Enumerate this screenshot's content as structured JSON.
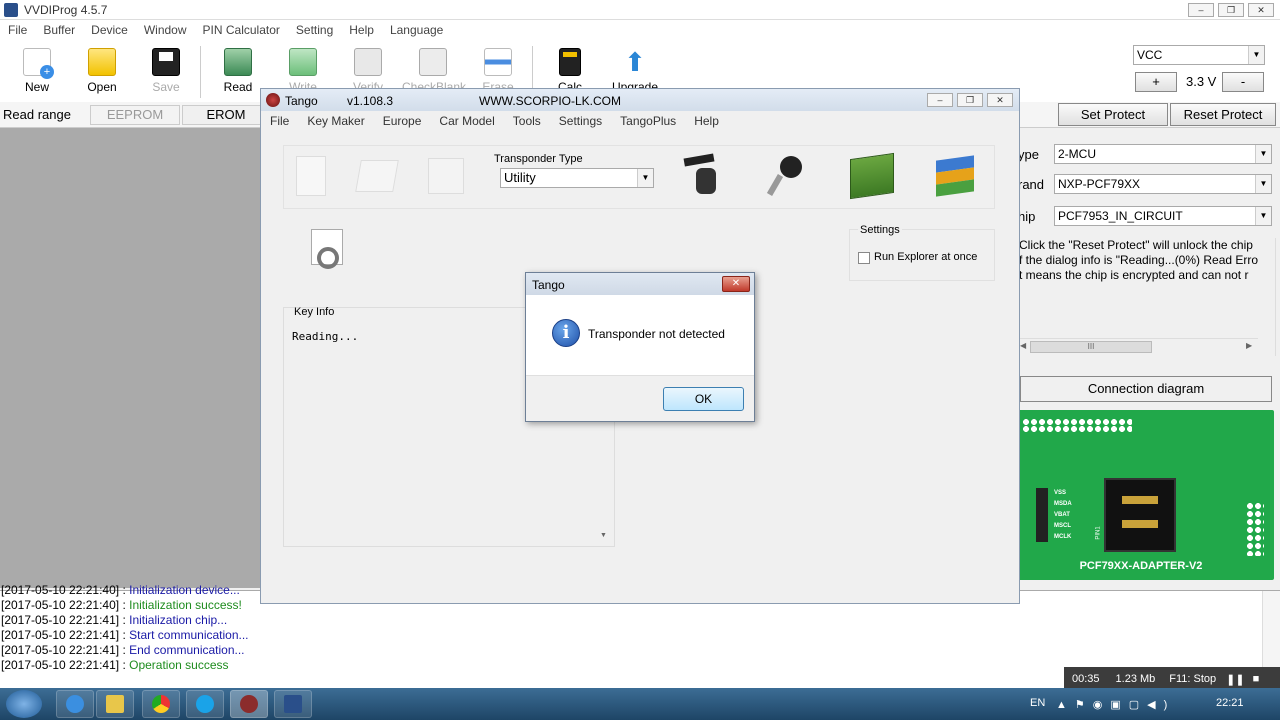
{
  "main_window": {
    "title": "VVDIProg 4.5.7",
    "menu": [
      "File",
      "Buffer",
      "Device",
      "Window",
      "PIN Calculator",
      "Setting",
      "Help",
      "Language"
    ],
    "toolbar": [
      {
        "label": "New",
        "icon": "new-file-icon",
        "enabled": true
      },
      {
        "label": "Open",
        "icon": "folder-icon",
        "enabled": true
      },
      {
        "label": "Save",
        "icon": "floppy-icon",
        "enabled": false
      },
      {
        "label": "Read",
        "icon": "read-icon",
        "enabled": true
      },
      {
        "label": "Write",
        "icon": "write-icon",
        "enabled": false
      },
      {
        "label": "Verify",
        "icon": "verify-icon",
        "enabled": false
      },
      {
        "label": "CheckBlank",
        "icon": "checkblank-icon",
        "enabled": false
      },
      {
        "label": "Erase",
        "icon": "erase-icon",
        "enabled": false
      },
      {
        "label": "Calc",
        "icon": "calculator-icon",
        "enabled": true
      },
      {
        "label": "Upgrade",
        "icon": "upgrade-arrow-icon",
        "enabled": true
      }
    ],
    "voltage": {
      "selected": "VCC",
      "value": "3.3 V",
      "plus": "+",
      "minus": "-"
    },
    "read_range_label": "Read range",
    "tabs": [
      "EEPROM",
      "EROM"
    ],
    "set_protect": "Set Protect",
    "reset_protect": "Reset Protect",
    "type_label": "ype",
    "type_value": "2-MCU",
    "brand_label": "rand",
    "brand_value": "NXP-PCF79XX",
    "chip_label": "hip",
    "chip_value": "PCF7953_IN_CIRCUIT",
    "info_lines": [
      "Click the \"Reset Protect\" will unlock the chip",
      "f the dialog info is \"Reading...(0%) Read Erro",
      "t means the chip is encrypted and can not r"
    ],
    "scroll_thumb": "III",
    "connection_button": "Connection diagram",
    "adapter": {
      "title": "PCF79XX-ADAPTER-V2",
      "pins": [
        "VSS",
        "MSDA",
        "VBAT",
        "MSCL",
        "MCLK"
      ],
      "pin1": "PIN1"
    }
  },
  "log": [
    {
      "time": "[2017-05-10 22:21:40]",
      "msg": "Initialization device...",
      "color": "#1a1aa6"
    },
    {
      "time": "[2017-05-10 22:21:40]",
      "msg": "Initialization success!",
      "color": "#1e8c1e"
    },
    {
      "time": "[2017-05-10 22:21:41]",
      "msg": "Initialization chip...",
      "color": "#1a1aa6"
    },
    {
      "time": "[2017-05-10 22:21:41]",
      "msg": "Start communication...",
      "color": "#1a1aa6"
    },
    {
      "time": "[2017-05-10 22:21:41]",
      "msg": "End communication...",
      "color": "#1a1aa6"
    },
    {
      "time": "[2017-05-10 22:21:41]",
      "msg": "Operation success",
      "color": "#1e8c1e"
    }
  ],
  "recorder": {
    "time": "00:35",
    "size": "1.23 Mb",
    "stop": "F11: Stop"
  },
  "tray": {
    "lang": "EN",
    "clock": "22:21"
  },
  "tango": {
    "title": "Tango",
    "version": "v1.108.3",
    "website": "WWW.SCORPIO-LK.COM",
    "menu": [
      "File",
      "Key Maker",
      "Europe",
      "Car Model",
      "Tools",
      "Settings",
      "TangoPlus",
      "Help"
    ],
    "transponder_type_label": "Transponder Type",
    "transponder_type_value": "Utility",
    "settings_label": "Settings",
    "run_explorer_label": "Run Explorer at once",
    "key_info_label": "Key Info",
    "key_info_text": "Reading..."
  },
  "dialog": {
    "title": "Tango",
    "message": "Transponder not detected",
    "ok": "OK",
    "close": "✕"
  }
}
